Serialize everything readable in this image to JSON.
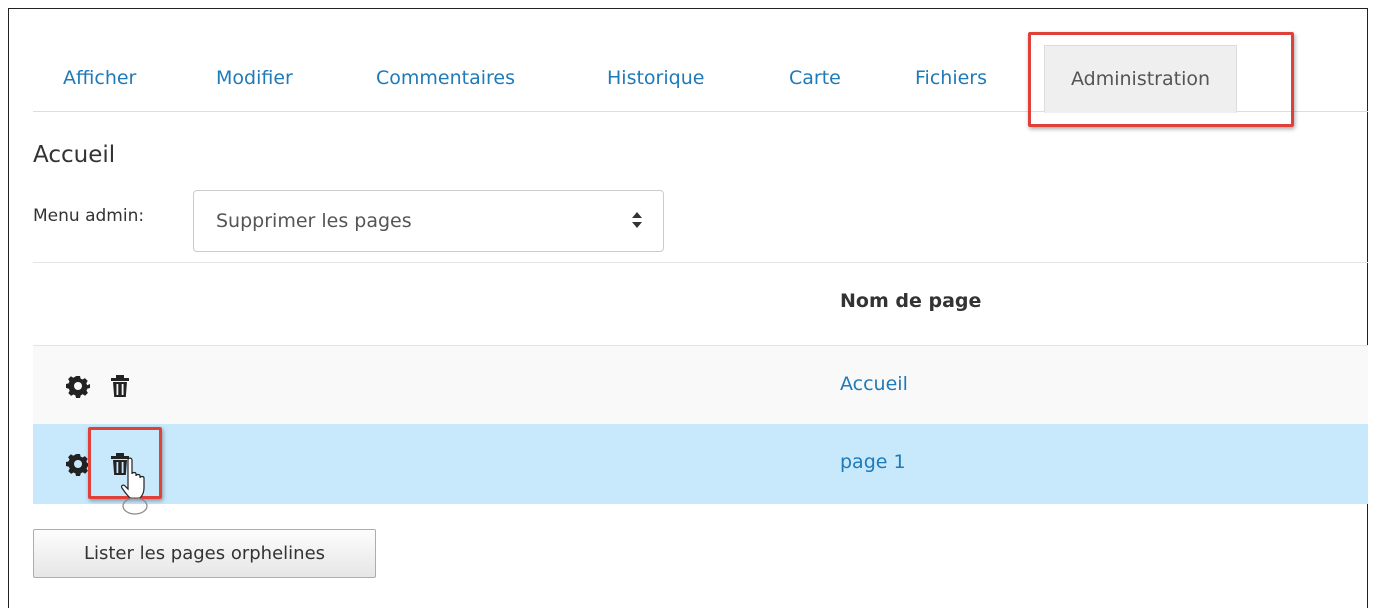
{
  "tabs": [
    {
      "label": "Afficher"
    },
    {
      "label": "Modifier"
    },
    {
      "label": "Commentaires"
    },
    {
      "label": "Historique"
    },
    {
      "label": "Carte"
    },
    {
      "label": "Fichiers"
    },
    {
      "label": "Administration",
      "active": true
    }
  ],
  "page": {
    "title": "Accueil"
  },
  "admin_menu": {
    "label": "Menu admin:",
    "selected": "Supprimer les pages"
  },
  "table": {
    "header": "Nom de page",
    "rows": [
      {
        "name": "Accueil",
        "icons": [
          "gear-icon",
          "trash-icon"
        ]
      },
      {
        "name": "page 1",
        "icons": [
          "gear-icon",
          "trash-icon"
        ],
        "selected": true
      }
    ]
  },
  "buttons": {
    "orphans": "Lister les pages orphelines"
  },
  "colors": {
    "link": "#1f7ab8",
    "highlight": "#e0403a",
    "selected_row": "#c7e9fb",
    "active_tab_bg": "#efefef"
  }
}
